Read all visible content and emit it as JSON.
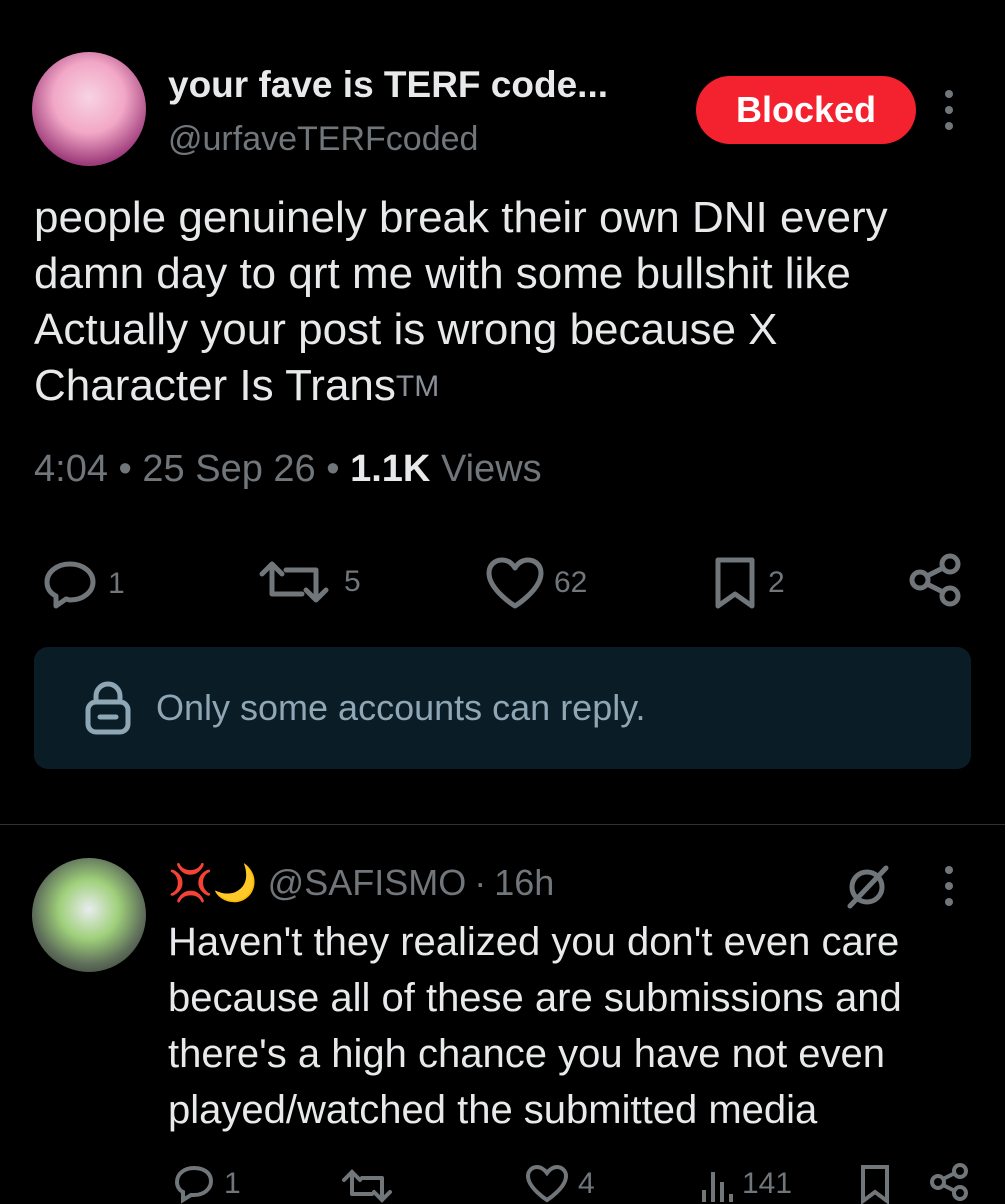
{
  "post": {
    "display_name": "your fave is TERF code...",
    "handle": "@urfaveTERFcoded",
    "blocked_label": "Blocked",
    "text": "people genuinely break their own DNI every damn day to qrt me with some bullshit like Actually your post is wrong because X Character Is Trans",
    "tm_mark": "TM",
    "time": "4:04",
    "date": "25 Sep 26",
    "views_count": "1.1K",
    "views_label": "Views",
    "actions": {
      "replies": "1",
      "reposts": "5",
      "likes": "62",
      "bookmarks": "2"
    },
    "reply_restriction": "Only some accounts can reply."
  },
  "reply": {
    "emojis": "💢🌙",
    "handle": "@SAFISMO",
    "separator": "·",
    "age": "16h",
    "text": "Haven't they realized you don't even care because all of these are submissions and there's a high chance you have not even played/watched the submitted media",
    "actions": {
      "replies": "1",
      "likes": "4",
      "views": "141"
    }
  },
  "icons": [
    "more-vertical-icon",
    "reply-icon",
    "repost-icon",
    "like-icon",
    "bookmark-icon",
    "share-icon",
    "lock-icon",
    "grok-icon",
    "views-icon"
  ],
  "colors": {
    "accent_red": "#f4212e",
    "muted": "#71767b",
    "text": "#e7e9ea",
    "restrict_bg": "#0a1d26"
  }
}
